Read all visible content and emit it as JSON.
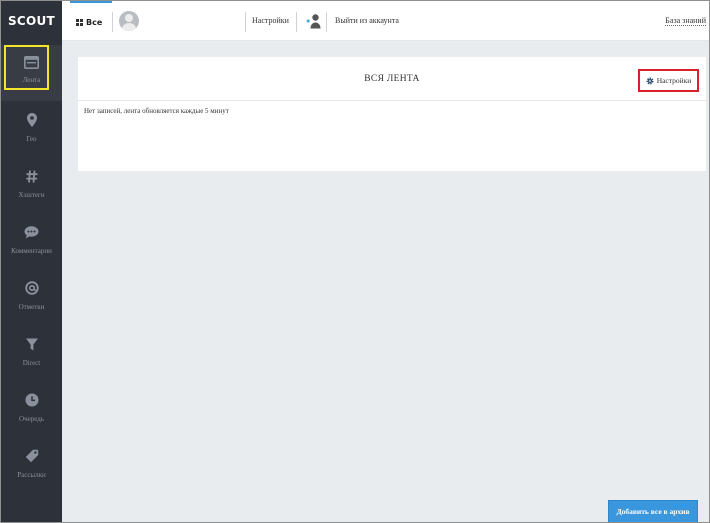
{
  "app": {
    "logo": "SCOUT"
  },
  "sidebar": {
    "items": [
      {
        "label": "Лента",
        "icon": "feed-icon",
        "active": true
      },
      {
        "label": "Гео",
        "icon": "geo-pin-icon"
      },
      {
        "label": "Хэштеги",
        "icon": "hashtag-icon"
      },
      {
        "label": "Комментарии",
        "icon": "comment-icon"
      },
      {
        "label": "Отметки",
        "icon": "at-mention-icon"
      },
      {
        "label": "Direct",
        "icon": "filter-funnel-icon"
      },
      {
        "label": "Очередь",
        "icon": "clock-icon"
      },
      {
        "label": "Рассылки",
        "icon": "tag-icon"
      }
    ]
  },
  "header": {
    "tab_all": "Все",
    "settings": "Настройки",
    "logout": "Выйти из аккаунта",
    "knowledge_base": "База знаний"
  },
  "feed": {
    "title": "ВСЯ ЛЕНТА",
    "settings_button": "Настройки",
    "empty_message": "Нет записей, лента обновляется каждые 5 минут"
  },
  "footer": {
    "archive_button": "Добавить все в архив"
  },
  "colors": {
    "sidebar_bg": "#2d3139",
    "accent": "#3498db",
    "highlight_yellow": "#f3e32a",
    "highlight_red": "#d8212b",
    "main_bg": "#e9ecef"
  }
}
